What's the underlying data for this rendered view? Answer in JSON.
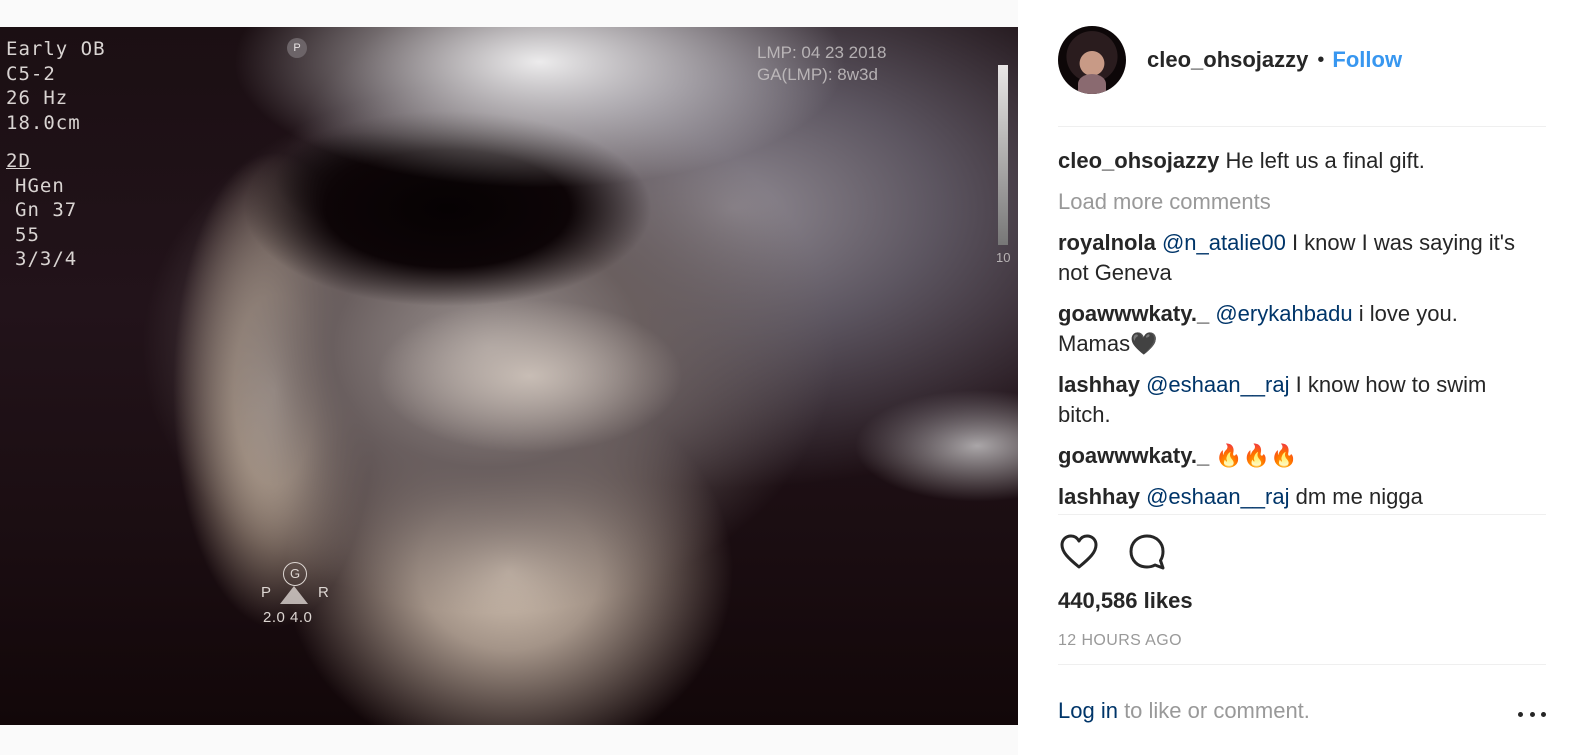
{
  "photo": {
    "overlay_left": {
      "lines_top": [
        "Early OB",
        "C5-2",
        "26 Hz",
        "18.0cm"
      ],
      "mode": "2D",
      "lines_bottom": [
        "HGen",
        "Gn 37",
        "55",
        "3/3/4"
      ]
    },
    "overlay_right": [
      "LMP: 04 23 2018",
      "GA(LMP): 8w3d"
    ],
    "probe_marker": "P",
    "depth_label": "10",
    "orientation": {
      "g": "G",
      "p": "P",
      "r": "R",
      "values": "2.0  4.0"
    }
  },
  "post": {
    "username": "cleo_ohsojazzy",
    "separator": "•",
    "follow_label": "Follow",
    "caption": {
      "user": "cleo_ohsojazzy",
      "text": "He left us a final gift."
    },
    "load_more_label": "Load more comments",
    "comments": [
      {
        "user": "royalnola",
        "mention": "@n_atalie00",
        "text": "I know I was saying it's not Geneva"
      },
      {
        "user": "goawwwkaty._",
        "mention": "@erykahbadu",
        "text": "i love you. Mamas🖤"
      },
      {
        "user": "lashhay",
        "mention": "@eshaan__raj",
        "text": "I know how to swim bitch."
      },
      {
        "user": "goawwwkaty._",
        "mention": "",
        "text": "🔥🔥🔥"
      },
      {
        "user": "lashhay",
        "mention": "@eshaan__raj",
        "text": "dm me nigga"
      }
    ],
    "icons": {
      "like": "heart-icon",
      "comment": "comment-bubble-icon",
      "more": "more-options-icon"
    },
    "likes": "440,586 likes",
    "timestamp": "12 HOURS AGO",
    "login_link": "Log in",
    "login_suffix": " to like or comment."
  }
}
